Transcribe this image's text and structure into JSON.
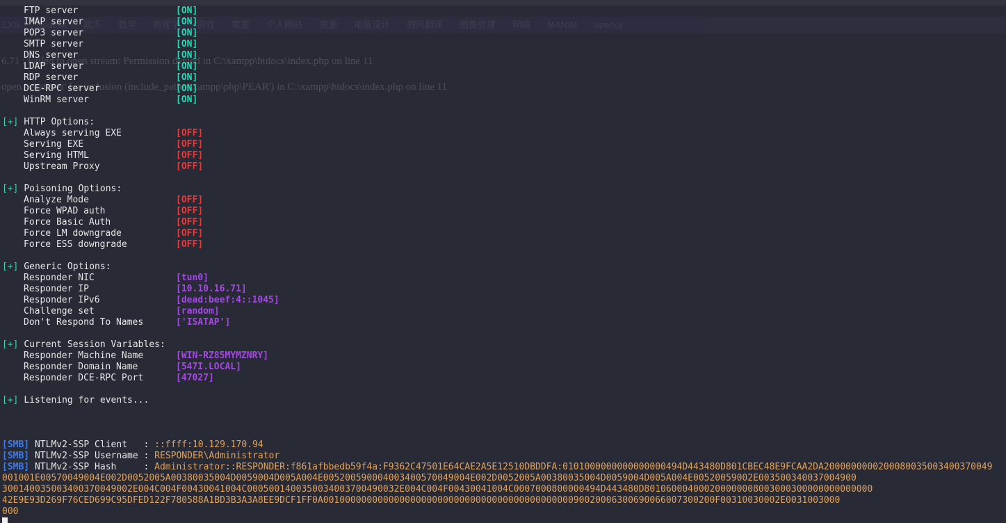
{
  "ghost_browser": {
    "bookmarks": [
      "LXS",
      "Sputnik",
      "娱乐",
      "数学",
      "物理学",
      "游戏",
      "家居",
      "个人网站",
      "资源",
      "电脑设计",
      "顾问翻译",
      "图像处理",
      "网络",
      "MANIM",
      "opency"
    ],
    "php_error_1": "6.71 : Failed to open stream: Permission denied in C:\\xampp\\htdocs\\index.php on line 11",
    "php_error_2": "open 'whatever' for inclusion (include_path='\\xampp\\php\\PEAR') in C:\\xampp\\htdocs\\index.php on line 11"
  },
  "servers": [
    {
      "label": "FTP server",
      "value": "[ON]"
    },
    {
      "label": "IMAP server",
      "value": "[ON]"
    },
    {
      "label": "POP3 server",
      "value": "[ON]"
    },
    {
      "label": "SMTP server",
      "value": "[ON]"
    },
    {
      "label": "DNS server",
      "value": "[ON]"
    },
    {
      "label": "LDAP server",
      "value": "[ON]"
    },
    {
      "label": "RDP server",
      "value": "[ON]"
    },
    {
      "label": "DCE-RPC server",
      "value": "[ON]"
    },
    {
      "label": "WinRM server",
      "value": "[ON]"
    }
  ],
  "sections": {
    "prefix": "[+]",
    "http_title": "HTTP Options:",
    "poison_title": "Poisoning Options:",
    "generic_title": "Generic Options:",
    "session_title": "Current Session Variables:",
    "listening": "Listening for events..."
  },
  "http_options": [
    {
      "label": "Always serving EXE",
      "value": "[OFF]"
    },
    {
      "label": "Serving EXE",
      "value": "[OFF]"
    },
    {
      "label": "Serving HTML",
      "value": "[OFF]"
    },
    {
      "label": "Upstream Proxy",
      "value": "[OFF]"
    }
  ],
  "poisoning_options": [
    {
      "label": "Analyze Mode",
      "value": "[OFF]"
    },
    {
      "label": "Force WPAD auth",
      "value": "[OFF]"
    },
    {
      "label": "Force Basic Auth",
      "value": "[OFF]"
    },
    {
      "label": "Force LM downgrade",
      "value": "[OFF]"
    },
    {
      "label": "Force ESS downgrade",
      "value": "[OFF]"
    }
  ],
  "generic_options": [
    {
      "label": "Responder NIC",
      "value": "[tun0]"
    },
    {
      "label": "Responder IP",
      "value": "[10.10.16.71]"
    },
    {
      "label": "Responder IPv6",
      "value": "[dead:beef:4::1045]"
    },
    {
      "label": "Challenge set",
      "value": "[random]"
    },
    {
      "label": "Don't Respond To Names",
      "value": "['ISATAP']"
    }
  ],
  "session_variables": [
    {
      "label": "Responder Machine Name",
      "value": "[WIN-RZ85MYMZNRY]"
    },
    {
      "label": "Responder Domain Name",
      "value": "[547I.LOCAL]"
    },
    {
      "label": "Responder DCE-RPC Port",
      "value": "[47027]"
    }
  ],
  "smb": {
    "tag": "[SMB]",
    "client_label": "NTLMv2-SSP Client   : ",
    "client_value": "::ffff:10.129.170.94",
    "username_label": "NTLMv2-SSP Username : ",
    "username_value": "RESPONDER\\Administrator",
    "hash_label": "NTLMv2-SSP Hash     : ",
    "hash_lines": [
      "Administrator::RESPONDER:f861afbbedb59f4a:F9362C47501E64CAE2A5E12510DBDDFA:0101000000000000000494D443480D801CBEC48E9FCAA2DA2000000000200080035003400370049",
      "001001E00570049004E002D0052005A00380035004D0059004D005A004E005200590004003400570049004E002D0052005A00380035004D0059004D005A004E00520059002E003500340037004900",
      "300140035003400370049002E004C004F00430041004C0005001400350034003700490032E004C004F00430041004C0007000800000494D443480D801060004000200000008003000300000000000000",
      "42E9E93D269F76CED699C95DFED122F780588A1BD3B3A3A8EE9DCF1FF0A001000000000000000000000000000000000000000000090020006300690066007300200F00310030002E0031003000",
      "000"
    ]
  }
}
